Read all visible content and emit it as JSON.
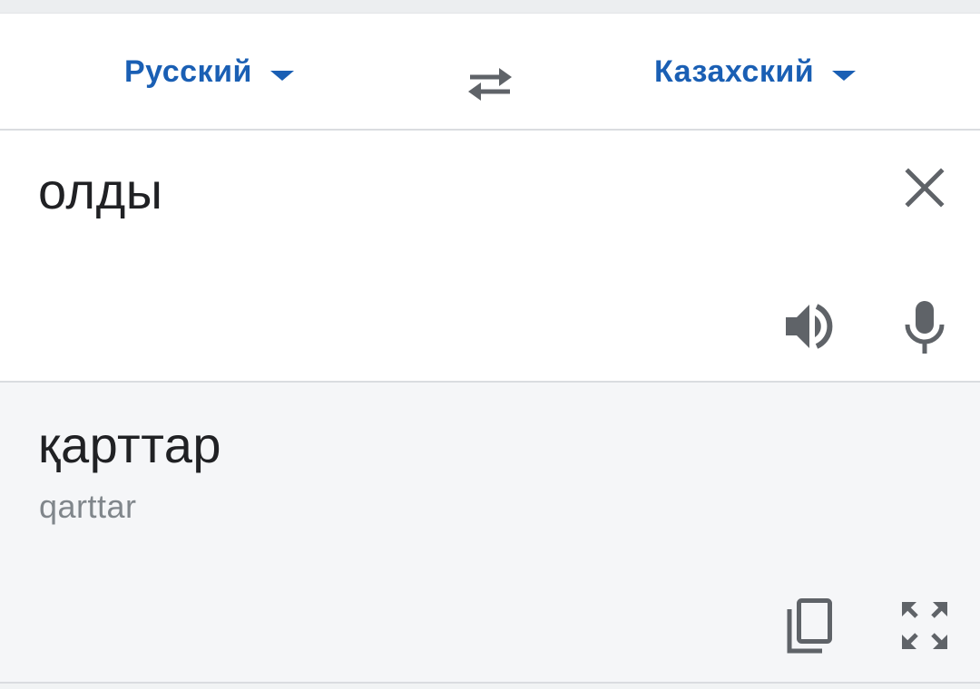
{
  "language_bar": {
    "source_language": "Русский",
    "target_language": "Казахский"
  },
  "input": {
    "text": "олды"
  },
  "output": {
    "translation": "қарттар",
    "transliteration": "qarttar"
  },
  "icons": {
    "swap": "swap-arrows-icon",
    "clear": "close-icon",
    "speaker": "speaker-icon",
    "microphone": "microphone-icon",
    "copy": "copy-icon",
    "fullscreen": "fullscreen-icon",
    "dropdown": "chevron-down-icon"
  },
  "colors": {
    "accent": "#1a5fb4",
    "icon": "#5f6368",
    "text": "#202124",
    "secondary_text": "#80868b",
    "output_background": "#f5f6f8"
  }
}
